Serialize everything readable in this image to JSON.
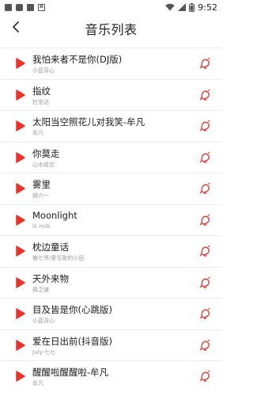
{
  "status_bar": {
    "time": "9:52"
  },
  "header": {
    "title": "音乐列表"
  },
  "songs": [
    {
      "title": "我怕来者不是你(DJ版)",
      "artist": "小蓝背心"
    },
    {
      "title": "指纹",
      "artist": "杜宣达"
    },
    {
      "title": "太阳当空照花儿对我笑-牟凡",
      "artist": "牟凡"
    },
    {
      "title": "你莫走",
      "artist": "山水组合"
    },
    {
      "title": "雾里",
      "artist": "姚六一"
    },
    {
      "title": "Moonlight",
      "artist": "lil milk"
    },
    {
      "title": "枕边童话",
      "artist": "傲七爷/爱写歌的小田"
    },
    {
      "title": "天外来物",
      "artist": "薛之谦"
    },
    {
      "title": "目及皆是你(心跳版)",
      "artist": "小蓝背心"
    },
    {
      "title": "爱在日出前(抖音版)",
      "artist": "July-七七"
    },
    {
      "title": "醒醒啦醒醒啦-牟凡",
      "artist": "牟凡"
    }
  ],
  "colors": {
    "accent": "#e8332a"
  }
}
